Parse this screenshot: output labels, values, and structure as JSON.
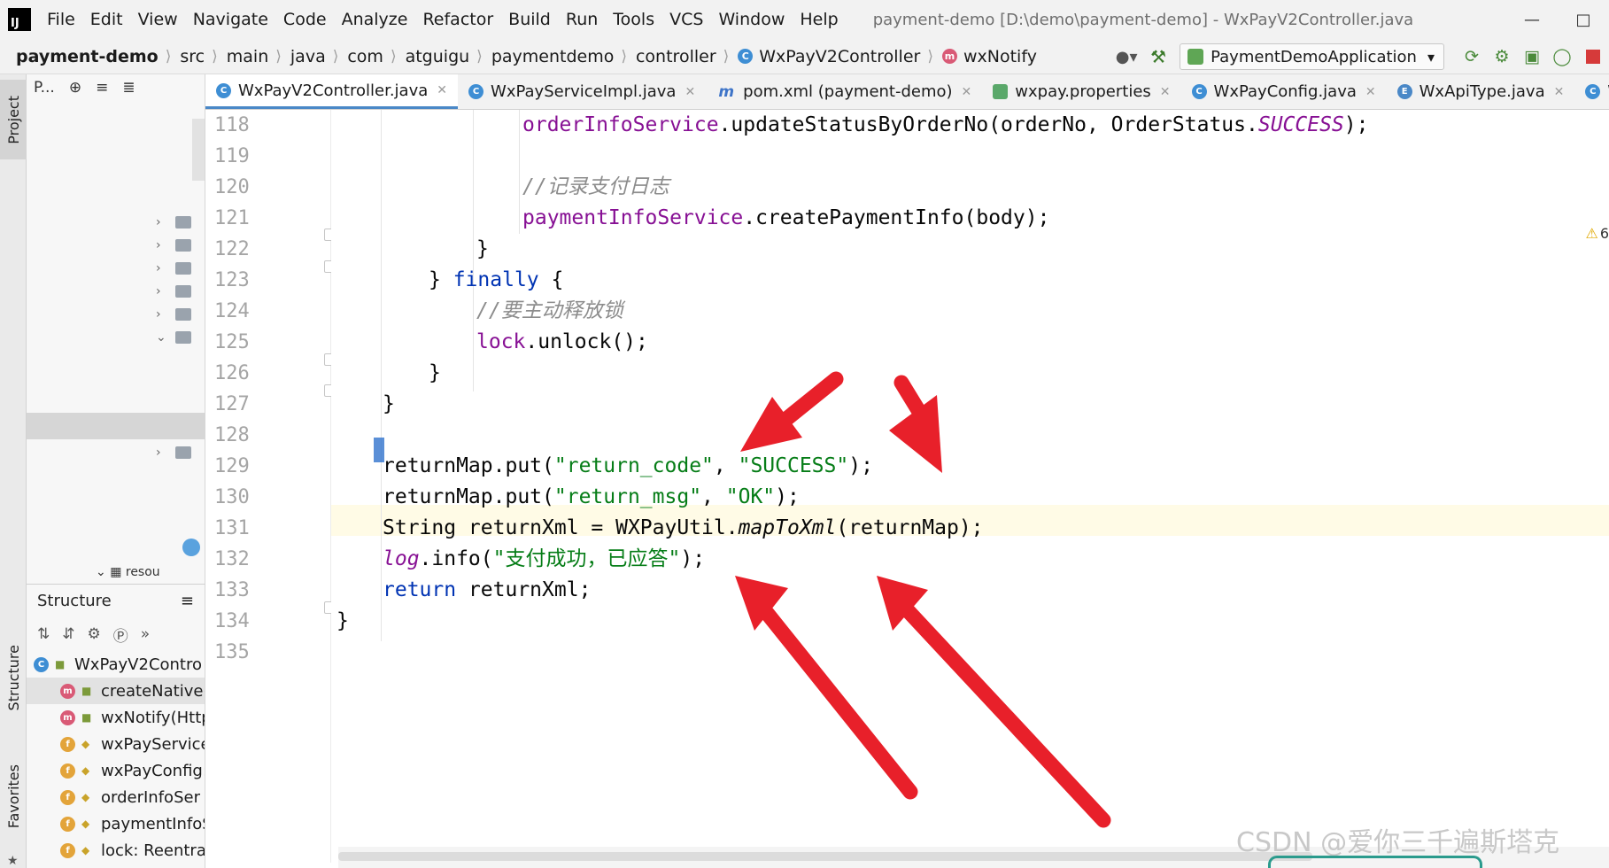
{
  "app": {
    "logo": "IJ",
    "menu": [
      "File",
      "Edit",
      "View",
      "Navigate",
      "Code",
      "Analyze",
      "Refactor",
      "Build",
      "Run",
      "Tools",
      "VCS",
      "Window",
      "Help"
    ],
    "window_title": "payment-demo [D:\\demo\\payment-demo] - WxPayV2Controller.java"
  },
  "breadcrumb": [
    {
      "label": "payment-demo",
      "icon": "",
      "bold": true
    },
    {
      "label": "src",
      "icon": ""
    },
    {
      "label": "main",
      "icon": ""
    },
    {
      "label": "java",
      "icon": ""
    },
    {
      "label": "com",
      "icon": ""
    },
    {
      "label": "atguigu",
      "icon": ""
    },
    {
      "label": "paymentdemo",
      "icon": ""
    },
    {
      "label": "controller",
      "icon": ""
    },
    {
      "label": "WxPayV2Controller",
      "icon": "class-icon"
    },
    {
      "label": "wxNotify",
      "icon": "method-icon"
    }
  ],
  "run_config": {
    "label": "PaymentDemoApplication"
  },
  "project_panel": {
    "toolbar_label": "P..."
  },
  "left_strip": {
    "project": "Project",
    "structure": "Structure",
    "favorites": "Favorites"
  },
  "structure_panel": {
    "title": "Structure",
    "items": [
      {
        "badge": "c",
        "label": "WxPayV2Contro",
        "root": true
      },
      {
        "badge": "m",
        "label": "createNative(",
        "selected": true
      },
      {
        "badge": "m",
        "label": "wxNotify(Http"
      },
      {
        "badge": "f",
        "label": "wxPayService"
      },
      {
        "badge": "f",
        "label": "wxPayConfig:"
      },
      {
        "badge": "f",
        "label": "orderInfoSer"
      },
      {
        "badge": "f",
        "label": "paymentInfoS"
      },
      {
        "badge": "f",
        "label": "lock: Reentra"
      }
    ],
    "resources_label": "resou"
  },
  "tabs": [
    {
      "label": "WxPayV2Controller.java",
      "icon": "class-icon",
      "active": true
    },
    {
      "label": "WxPayServiceImpl.java",
      "icon": "class-icon"
    },
    {
      "label": "pom.xml (payment-demo)",
      "icon": "maven-icon"
    },
    {
      "label": "wxpay.properties",
      "icon": "properties-icon"
    },
    {
      "label": "WxPayConfig.java",
      "icon": "class-icon"
    },
    {
      "label": "WxApiType.java",
      "icon": "enum-icon"
    },
    {
      "label": "Wx",
      "icon": "class-icon"
    }
  ],
  "editor": {
    "line_numbers": [
      "118",
      "119",
      "120",
      "121",
      "122",
      "123",
      "124",
      "125",
      "126",
      "127",
      "128",
      "129",
      "130",
      "131",
      "132",
      "133",
      "134",
      "135"
    ],
    "warning_count": "6"
  },
  "watermark": "CSDN @爱你三千遍斯塔克",
  "colors": {
    "arrow": "#e8202a",
    "caret": "#3d7bd0",
    "keyword": "#0033b3",
    "string": "#067d17",
    "field": "#871094",
    "comment": "#8c8c8c"
  }
}
